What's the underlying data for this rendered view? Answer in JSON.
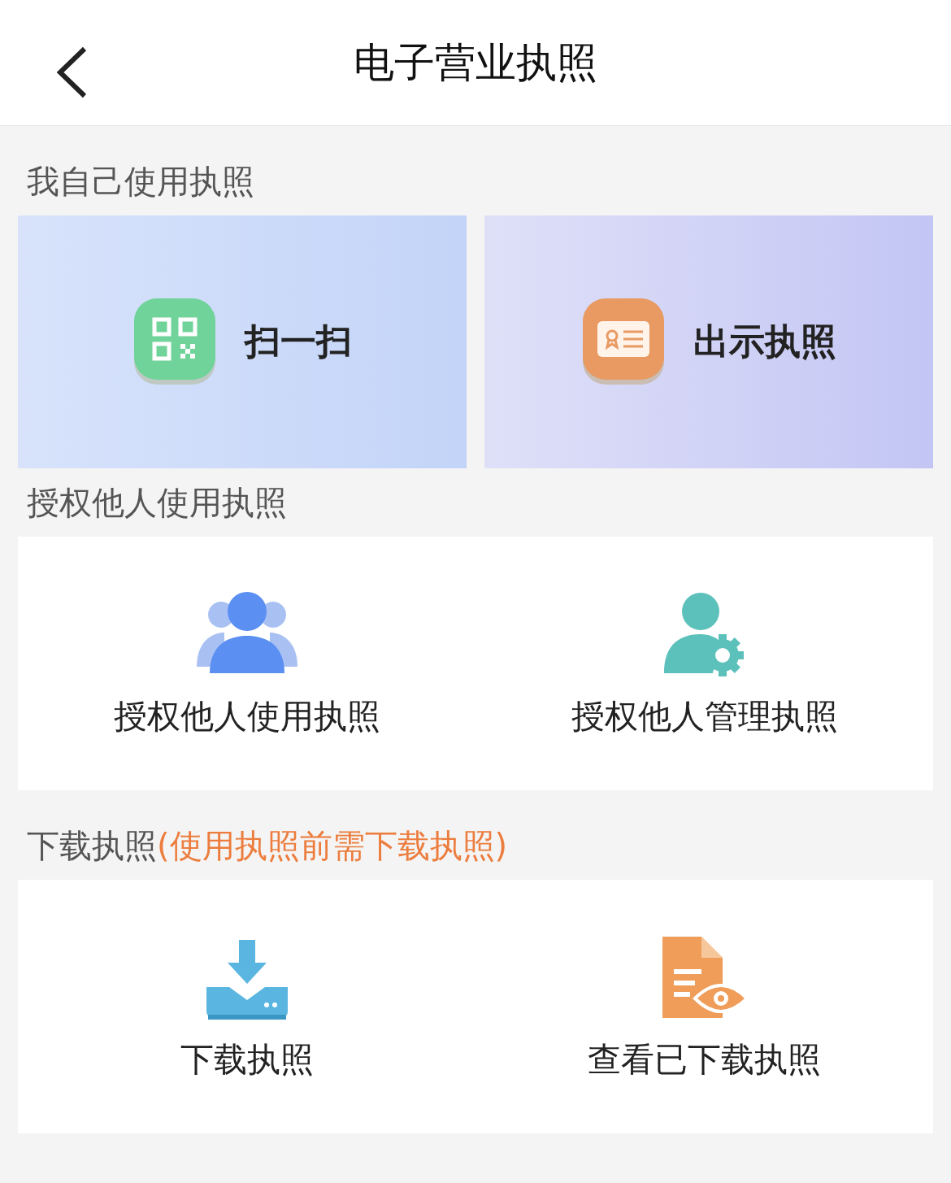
{
  "header": {
    "title": "电子营业执照"
  },
  "sections": [
    {
      "kind": "quick",
      "title": "我自己使用执照",
      "items": [
        {
          "kind": "scan",
          "label": "扫一扫"
        },
        {
          "kind": "show",
          "label": "出示执照"
        }
      ]
    },
    {
      "kind": "grid",
      "title": "授权他人使用执照",
      "items": [
        {
          "kind": "authorize_use",
          "label": "授权他人使用执照"
        },
        {
          "kind": "authorize_manage",
          "label": "授权他人管理执照"
        }
      ]
    },
    {
      "kind": "grid",
      "title": "下载执照",
      "note": "(使用执照前需下载执照)",
      "items": [
        {
          "kind": "download",
          "label": "下载执照"
        },
        {
          "kind": "view_downloaded",
          "label": "查看已下载执照"
        }
      ]
    }
  ]
}
